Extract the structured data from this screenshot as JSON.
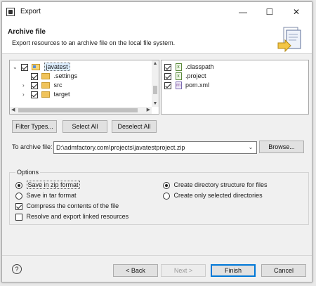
{
  "window": {
    "title": "Export",
    "minimize": "—",
    "maximize": "☐",
    "close": "✕"
  },
  "banner": {
    "title": "Archive file",
    "description": "Export resources to an archive file on the local file system."
  },
  "tree": {
    "project": {
      "label": "javatest",
      "checked": true,
      "expanded": true
    },
    "children": [
      {
        "label": ".settings",
        "checked": true,
        "expandable": false
      },
      {
        "label": "src",
        "checked": true,
        "expandable": true
      },
      {
        "label": "target",
        "checked": true,
        "expandable": true
      }
    ]
  },
  "files": [
    {
      "label": ".classpath",
      "checked": true,
      "icon": "xml-file-icon"
    },
    {
      "label": ".project",
      "checked": true,
      "icon": "xml-file-icon"
    },
    {
      "label": "pom.xml",
      "checked": true,
      "icon": "maven-pom-icon"
    }
  ],
  "buttons": {
    "filter_types": "Filter Types...",
    "select_all": "Select All",
    "deselect_all": "Deselect All",
    "browse": "Browse...",
    "back": "< Back",
    "next": "Next >",
    "finish": "Finish",
    "cancel": "Cancel"
  },
  "archive": {
    "label": "To archive file:",
    "value": "D:\\admfactory.com\\projects\\javatestproject.zip"
  },
  "options": {
    "title": "Options",
    "format_zip": "Save in zip format",
    "format_tar": "Save in tar format",
    "compress": "Compress the contents of the file",
    "resolve_links": "Resolve and export linked resources",
    "create_dir_structure": "Create directory structure for files",
    "create_selected_dirs": "Create only selected directories",
    "selected_format": "zip",
    "compress_checked": true,
    "resolve_checked": false,
    "selected_structure": "directory-structure"
  },
  "help": {
    "symbol": "?"
  }
}
